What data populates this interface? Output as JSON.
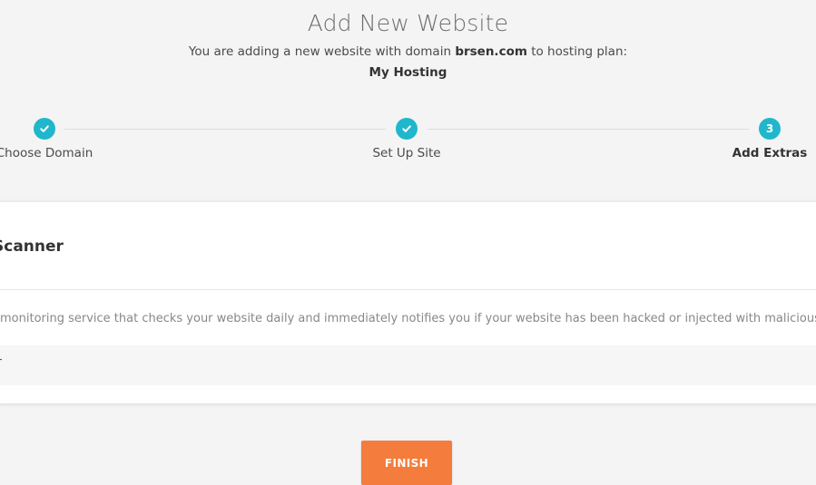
{
  "header": {
    "title": "Add New Website",
    "subtitle_prefix": "You are adding a new website with domain ",
    "domain": "brsen.com",
    "subtitle_suffix": " to hosting plan:",
    "plan": "My Hosting"
  },
  "steps": [
    {
      "label": "Choose Domain",
      "state": "done",
      "icon": "check-icon"
    },
    {
      "label": "Set Up Site",
      "state": "done",
      "icon": "check-icon"
    },
    {
      "label": "Add Extras",
      "state": "active",
      "number": "3"
    }
  ],
  "extra": {
    "title": "Scanner",
    "description": "monitoring service that checks your website daily and immediately notifies you if your website has been hacked or injected with malicious",
    "row_text": "T"
  },
  "actions": {
    "finish_label": "FINISH"
  },
  "colors": {
    "accent": "#20b7cc",
    "button": "#f47c3c",
    "background": "#f4f4f4"
  }
}
